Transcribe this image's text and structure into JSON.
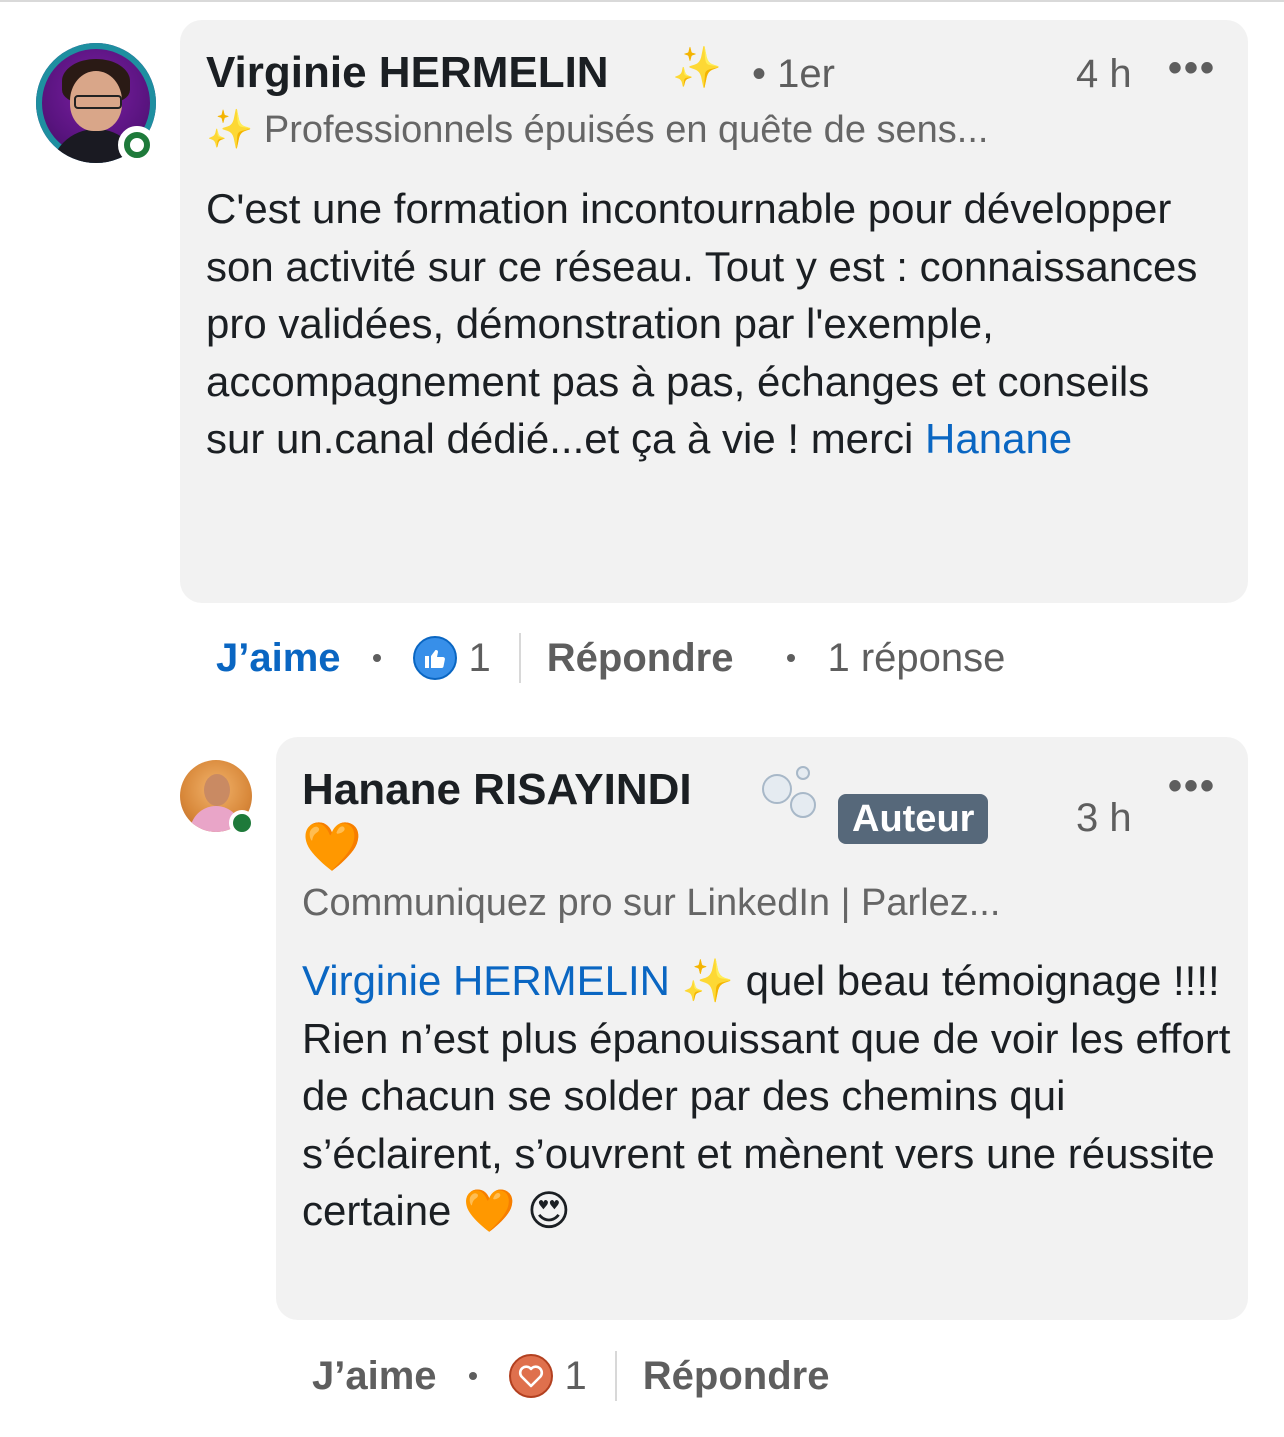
{
  "comment1": {
    "author": "Virginie HERMELIN",
    "author_emoji": "✨",
    "degree": "• 1er",
    "time": "4 h",
    "more": "•••",
    "headline": "✨ Professionnels épuisés en quête de sens...",
    "body_text": "C'est une formation incontournable pour développer son activité sur ce réseau.  Tout y est : connaissances pro validées, démonstration par l'exemple, accompagnement pas à pas,  échanges et conseils sur un.canal dédié...et ça à vie ! merci ",
    "mention": "Hanane",
    "actions": {
      "like_label": "J’aime",
      "reaction_icon": "thumbs-up-icon",
      "reaction_count": "1",
      "reply_label": "Répondre",
      "reply_count_label": "1 réponse"
    }
  },
  "comment2": {
    "author": "Hanane RISAYINDI",
    "author_emoji_icon": "bubbles-icon",
    "author_heart": "🧡",
    "badge": "Auteur",
    "time": "3 h",
    "more": "•••",
    "headline": "Communiquez pro sur LinkedIn | Parlez...",
    "mention": "Virginie HERMELIN ✨",
    "body_text": " quel beau témoignage !!!! Rien n’est plus épanouissant que de voir les effort de chacun se solder par des chemins qui s’éclairent, s’ouvrent et mènent vers une réussite certaine 🧡 😍",
    "actions": {
      "like_label": "J’aime",
      "reaction_icon": "heart-icon",
      "reaction_count": "1",
      "reply_label": "Répondre"
    }
  },
  "colors": {
    "link_blue": "#0a66c2",
    "bubble_bg": "#f2f2f2",
    "muted_text": "#5e5e5e",
    "badge_bg": "#56687a",
    "presence_green": "#1e7a3a"
  }
}
